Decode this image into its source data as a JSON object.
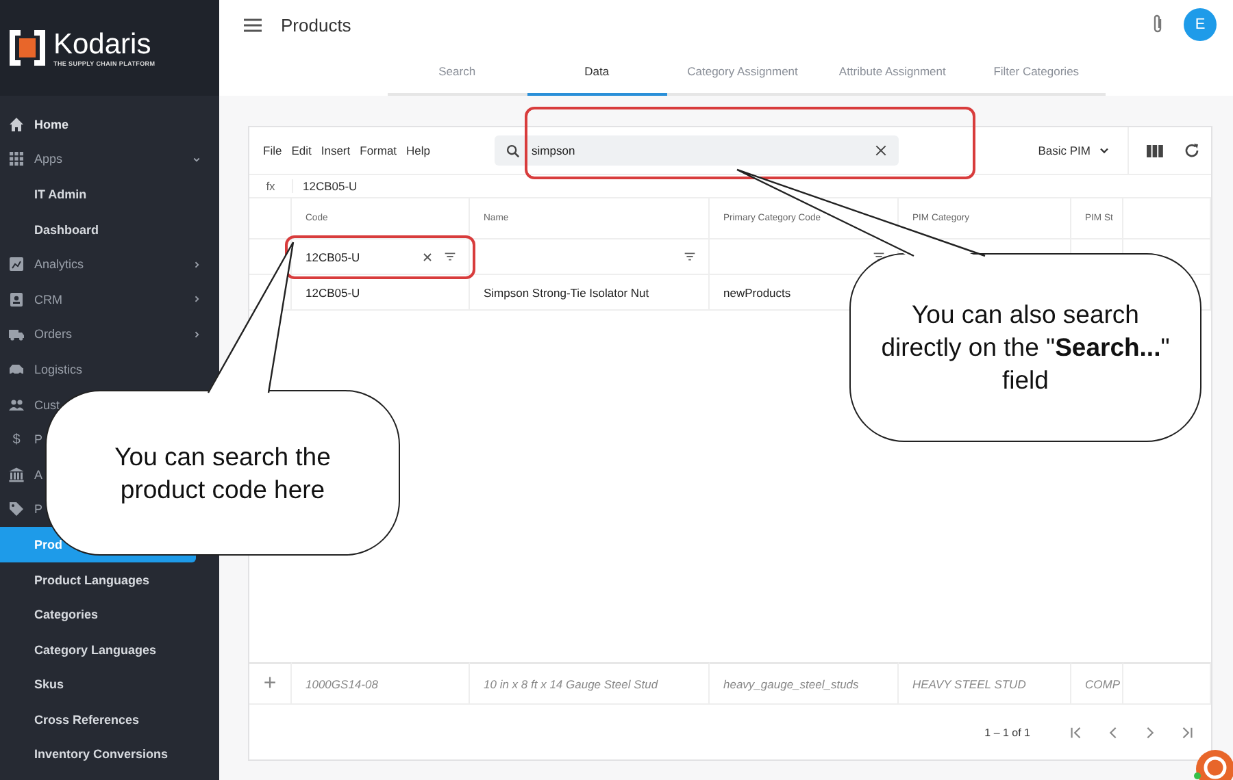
{
  "sidebar": {
    "logo": {
      "name": "Kodaris",
      "tagline": "THE SUPPLY CHAIN PLATFORM"
    },
    "items": [
      {
        "label": "Home",
        "bright": true
      },
      {
        "label": "Apps",
        "bright": false,
        "expanded": true,
        "children": [
          {
            "label": "IT Admin",
            "selected": false
          },
          {
            "label": "Dashboard",
            "selected": false
          }
        ]
      },
      {
        "label": "Analytics",
        "bright": false,
        "expanded": false
      },
      {
        "label": "CRM",
        "bright": false,
        "expanded": false
      },
      {
        "label": "Orders",
        "bright": false,
        "expanded": false
      },
      {
        "label": "Logistics",
        "bright": false
      },
      {
        "label": "Cust",
        "bright": false
      },
      {
        "label": "P",
        "bright": false,
        "glyph": "$"
      },
      {
        "label": "A",
        "bright": false
      },
      {
        "label": "P",
        "bright": false,
        "children": [
          {
            "label": "Prod",
            "selected": true
          },
          {
            "label": "Product Languages",
            "selected": false
          },
          {
            "label": "Categories",
            "selected": false
          },
          {
            "label": "Category Languages",
            "selected": false
          },
          {
            "label": "Skus",
            "selected": false
          },
          {
            "label": "Cross References",
            "selected": false
          },
          {
            "label": "Inventory Conversions",
            "selected": false
          }
        ]
      }
    ]
  },
  "header": {
    "title": "Products",
    "avatar": "E"
  },
  "tabs": [
    {
      "label": "Search",
      "selected": false
    },
    {
      "label": "Data",
      "selected": true
    },
    {
      "label": "Category Assignment",
      "selected": false
    },
    {
      "label": "Attribute Assignment",
      "selected": false
    },
    {
      "label": "Filter Categories",
      "selected": false
    }
  ],
  "grid": {
    "menu": [
      "File",
      "Edit",
      "Insert",
      "Format",
      "Help"
    ],
    "search": {
      "value": "simpson"
    },
    "view": "Basic PIM",
    "formula": {
      "label": "fx",
      "value": "12CB05-U"
    },
    "columns": [
      {
        "label": "Code",
        "filter": "12CB05-U"
      },
      {
        "label": "Name"
      },
      {
        "label": "Primary Category Code"
      },
      {
        "label": "PIM Category"
      },
      {
        "label": "PIM St"
      }
    ],
    "rows": [
      [
        "12CB05-U",
        "Simpson Strong-Tie Isolator Nut",
        "newProducts"
      ]
    ],
    "pinned_row": {
      "add": "+",
      "cells": [
        "1000GS14-08",
        "10 in x 8 ft x 14 Gauge Steel Stud",
        "heavy_gauge_steel_studs",
        "HEAVY STEEL STUD",
        "COMP"
      ]
    },
    "pagination": "1 – 1 of 1"
  },
  "callouts": [
    {
      "text": "You can also search directly on the \"**Search...**\" field"
    },
    {
      "text": "You can search the product code here"
    }
  ]
}
